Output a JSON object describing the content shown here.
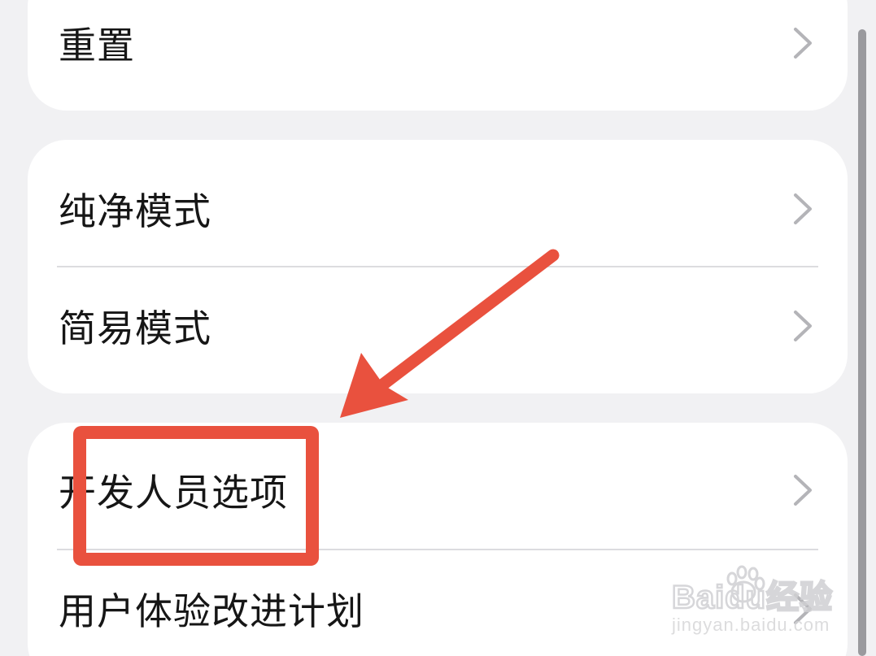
{
  "settings": {
    "items": [
      {
        "label": "重置"
      },
      {
        "label": "纯净模式"
      },
      {
        "label": "简易模式"
      },
      {
        "label": "开发人员选项"
      },
      {
        "label": "用户体验改进计划"
      }
    ]
  },
  "watermark": {
    "brand": "Baidu经验",
    "domain": "jingyan.baidu.com"
  },
  "colors": {
    "background": "#f1f1f3",
    "card": "#ffffff",
    "text": "#161616",
    "chevron": "#b4b4b8",
    "annotation": "#e9513e"
  }
}
